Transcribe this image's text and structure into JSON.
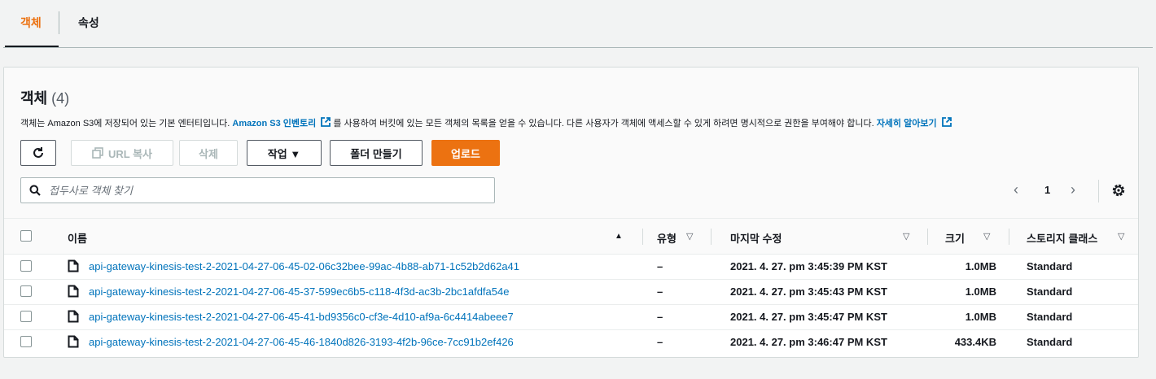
{
  "tabs": [
    {
      "label": "객체",
      "active": true
    },
    {
      "label": "속성",
      "active": false
    }
  ],
  "panel": {
    "title": "객체",
    "count": "(4)",
    "description": {
      "part1": "객체는 Amazon S3에 저장되어 있는 기본 엔터티입니다. ",
      "link1": "Amazon S3 인벤토리",
      "part2": "를 사용하여 버킷에 있는 모든 객체의 목록을 얻을 수 있습니다. 다른 사용자가 객체에 액세스할 수 있게 하려면 명시적으로 권한을 부여해야 합니다. ",
      "link2": "자세히 알아보기"
    }
  },
  "toolbar": {
    "refresh_icon": "refresh-icon",
    "copy_url_label": "URL 복사",
    "delete_label": "삭제",
    "actions_label": "작업 ▼",
    "create_folder_label": "폴더 만들기",
    "upload_label": "업로드"
  },
  "search": {
    "placeholder": "접두사로 객체 찾기",
    "value": ""
  },
  "pagination": {
    "current_page": "1",
    "prev": "‹",
    "next": "›"
  },
  "table": {
    "columns": {
      "name": "이름",
      "type": "유형",
      "modified": "마지막 수정",
      "size": "크기",
      "storage": "스토리지 클래스"
    },
    "rows": [
      {
        "name": "api-gateway-kinesis-test-2-2021-04-27-06-45-02-06c32bee-99ac-4b88-ab71-1c52b2d62a41",
        "type": "–",
        "modified": "2021. 4. 27. pm 3:45:39 PM KST",
        "size": "1.0MB",
        "storage": "Standard"
      },
      {
        "name": "api-gateway-kinesis-test-2-2021-04-27-06-45-37-599ec6b5-c118-4f3d-ac3b-2bc1afdfa54e",
        "type": "–",
        "modified": "2021. 4. 27. pm 3:45:43 PM KST",
        "size": "1.0MB",
        "storage": "Standard"
      },
      {
        "name": "api-gateway-kinesis-test-2-2021-04-27-06-45-41-bd9356c0-cf3e-4d10-af9a-6c4414abeee7",
        "type": "–",
        "modified": "2021. 4. 27. pm 3:45:47 PM KST",
        "size": "1.0MB",
        "storage": "Standard"
      },
      {
        "name": "api-gateway-kinesis-test-2-2021-04-27-06-45-46-1840d826-3193-4f2b-96ce-7cc91b2ef426",
        "type": "–",
        "modified": "2021. 4. 27. pm 3:46:47 PM KST",
        "size": "433.4KB",
        "storage": "Standard"
      }
    ]
  },
  "colors": {
    "accent": "#ec7211",
    "link": "#0073bb",
    "text": "#16191f"
  }
}
